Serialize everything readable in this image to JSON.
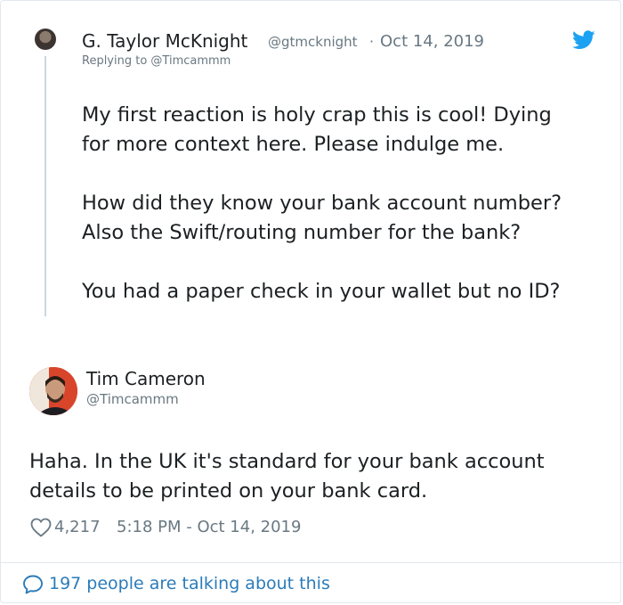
{
  "reply_tweet": {
    "author_name": "G. Taylor McKnight",
    "author_handle": "@gtmcknight",
    "separator": "·",
    "date": "Oct 14, 2019",
    "replying_to": "Replying to @Timcammm",
    "paragraphs": [
      [
        "My first reaction is holy crap this is cool! Dying",
        "for more context here. Please indulge me."
      ],
      [
        "How did they know your bank account number?",
        "Also the Swift/routing number for the bank?"
      ],
      [
        "You had a paper check in your wallet but no ID?"
      ]
    ]
  },
  "main_tweet": {
    "author_name": "Tim Cameron",
    "author_handle": "@Timcammm",
    "text_lines": [
      "Haha. In the UK it's standard for your bank account",
      "details to be printed on your bank card."
    ],
    "like_count": "4,217",
    "timestamp": "5:18 PM - Oct 14, 2019"
  },
  "footer": {
    "conversation_label": "197 people are talking about this"
  },
  "icons": {
    "twitter": "twitter-bird-icon",
    "like": "heart-icon",
    "conversation": "speech-bubble-icon"
  },
  "colors": {
    "brand_blue": "#1da1f2",
    "link_blue": "#2b7bb9",
    "muted_text": "#697882",
    "body_text": "#1c2022",
    "thread_line": "#ccd6dd"
  }
}
